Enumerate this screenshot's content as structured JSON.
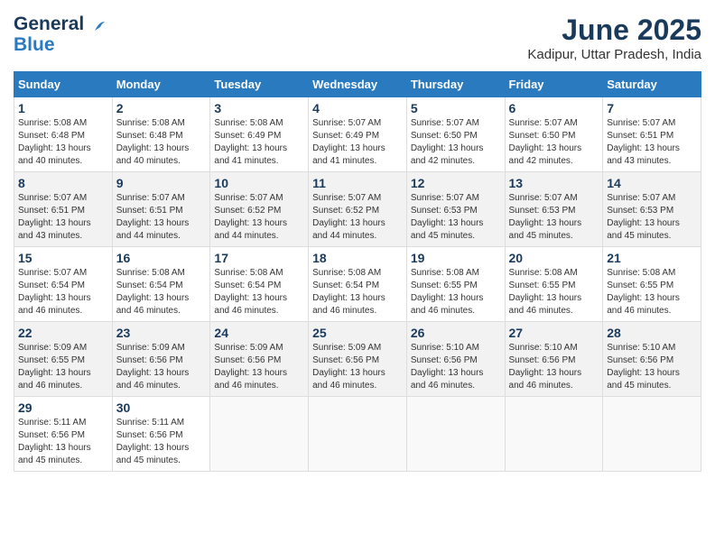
{
  "logo": {
    "line1": "General",
    "line2": "Blue"
  },
  "title": "June 2025",
  "subtitle": "Kadipur, Uttar Pradesh, India",
  "days_of_week": [
    "Sunday",
    "Monday",
    "Tuesday",
    "Wednesday",
    "Thursday",
    "Friday",
    "Saturday"
  ],
  "weeks": [
    [
      {
        "day": "1",
        "sunrise": "Sunrise: 5:08 AM",
        "sunset": "Sunset: 6:48 PM",
        "daylight": "Daylight: 13 hours and 40 minutes."
      },
      {
        "day": "2",
        "sunrise": "Sunrise: 5:08 AM",
        "sunset": "Sunset: 6:48 PM",
        "daylight": "Daylight: 13 hours and 40 minutes."
      },
      {
        "day": "3",
        "sunrise": "Sunrise: 5:08 AM",
        "sunset": "Sunset: 6:49 PM",
        "daylight": "Daylight: 13 hours and 41 minutes."
      },
      {
        "day": "4",
        "sunrise": "Sunrise: 5:07 AM",
        "sunset": "Sunset: 6:49 PM",
        "daylight": "Daylight: 13 hours and 41 minutes."
      },
      {
        "day": "5",
        "sunrise": "Sunrise: 5:07 AM",
        "sunset": "Sunset: 6:50 PM",
        "daylight": "Daylight: 13 hours and 42 minutes."
      },
      {
        "day": "6",
        "sunrise": "Sunrise: 5:07 AM",
        "sunset": "Sunset: 6:50 PM",
        "daylight": "Daylight: 13 hours and 42 minutes."
      },
      {
        "day": "7",
        "sunrise": "Sunrise: 5:07 AM",
        "sunset": "Sunset: 6:51 PM",
        "daylight": "Daylight: 13 hours and 43 minutes."
      }
    ],
    [
      {
        "day": "8",
        "sunrise": "Sunrise: 5:07 AM",
        "sunset": "Sunset: 6:51 PM",
        "daylight": "Daylight: 13 hours and 43 minutes."
      },
      {
        "day": "9",
        "sunrise": "Sunrise: 5:07 AM",
        "sunset": "Sunset: 6:51 PM",
        "daylight": "Daylight: 13 hours and 44 minutes."
      },
      {
        "day": "10",
        "sunrise": "Sunrise: 5:07 AM",
        "sunset": "Sunset: 6:52 PM",
        "daylight": "Daylight: 13 hours and 44 minutes."
      },
      {
        "day": "11",
        "sunrise": "Sunrise: 5:07 AM",
        "sunset": "Sunset: 6:52 PM",
        "daylight": "Daylight: 13 hours and 44 minutes."
      },
      {
        "day": "12",
        "sunrise": "Sunrise: 5:07 AM",
        "sunset": "Sunset: 6:53 PM",
        "daylight": "Daylight: 13 hours and 45 minutes."
      },
      {
        "day": "13",
        "sunrise": "Sunrise: 5:07 AM",
        "sunset": "Sunset: 6:53 PM",
        "daylight": "Daylight: 13 hours and 45 minutes."
      },
      {
        "day": "14",
        "sunrise": "Sunrise: 5:07 AM",
        "sunset": "Sunset: 6:53 PM",
        "daylight": "Daylight: 13 hours and 45 minutes."
      }
    ],
    [
      {
        "day": "15",
        "sunrise": "Sunrise: 5:07 AM",
        "sunset": "Sunset: 6:54 PM",
        "daylight": "Daylight: 13 hours and 46 minutes."
      },
      {
        "day": "16",
        "sunrise": "Sunrise: 5:08 AM",
        "sunset": "Sunset: 6:54 PM",
        "daylight": "Daylight: 13 hours and 46 minutes."
      },
      {
        "day": "17",
        "sunrise": "Sunrise: 5:08 AM",
        "sunset": "Sunset: 6:54 PM",
        "daylight": "Daylight: 13 hours and 46 minutes."
      },
      {
        "day": "18",
        "sunrise": "Sunrise: 5:08 AM",
        "sunset": "Sunset: 6:54 PM",
        "daylight": "Daylight: 13 hours and 46 minutes."
      },
      {
        "day": "19",
        "sunrise": "Sunrise: 5:08 AM",
        "sunset": "Sunset: 6:55 PM",
        "daylight": "Daylight: 13 hours and 46 minutes."
      },
      {
        "day": "20",
        "sunrise": "Sunrise: 5:08 AM",
        "sunset": "Sunset: 6:55 PM",
        "daylight": "Daylight: 13 hours and 46 minutes."
      },
      {
        "day": "21",
        "sunrise": "Sunrise: 5:08 AM",
        "sunset": "Sunset: 6:55 PM",
        "daylight": "Daylight: 13 hours and 46 minutes."
      }
    ],
    [
      {
        "day": "22",
        "sunrise": "Sunrise: 5:09 AM",
        "sunset": "Sunset: 6:55 PM",
        "daylight": "Daylight: 13 hours and 46 minutes."
      },
      {
        "day": "23",
        "sunrise": "Sunrise: 5:09 AM",
        "sunset": "Sunset: 6:56 PM",
        "daylight": "Daylight: 13 hours and 46 minutes."
      },
      {
        "day": "24",
        "sunrise": "Sunrise: 5:09 AM",
        "sunset": "Sunset: 6:56 PM",
        "daylight": "Daylight: 13 hours and 46 minutes."
      },
      {
        "day": "25",
        "sunrise": "Sunrise: 5:09 AM",
        "sunset": "Sunset: 6:56 PM",
        "daylight": "Daylight: 13 hours and 46 minutes."
      },
      {
        "day": "26",
        "sunrise": "Sunrise: 5:10 AM",
        "sunset": "Sunset: 6:56 PM",
        "daylight": "Daylight: 13 hours and 46 minutes."
      },
      {
        "day": "27",
        "sunrise": "Sunrise: 5:10 AM",
        "sunset": "Sunset: 6:56 PM",
        "daylight": "Daylight: 13 hours and 46 minutes."
      },
      {
        "day": "28",
        "sunrise": "Sunrise: 5:10 AM",
        "sunset": "Sunset: 6:56 PM",
        "daylight": "Daylight: 13 hours and 45 minutes."
      }
    ],
    [
      {
        "day": "29",
        "sunrise": "Sunrise: 5:11 AM",
        "sunset": "Sunset: 6:56 PM",
        "daylight": "Daylight: 13 hours and 45 minutes."
      },
      {
        "day": "30",
        "sunrise": "Sunrise: 5:11 AM",
        "sunset": "Sunset: 6:56 PM",
        "daylight": "Daylight: 13 hours and 45 minutes."
      },
      null,
      null,
      null,
      null,
      null
    ]
  ]
}
